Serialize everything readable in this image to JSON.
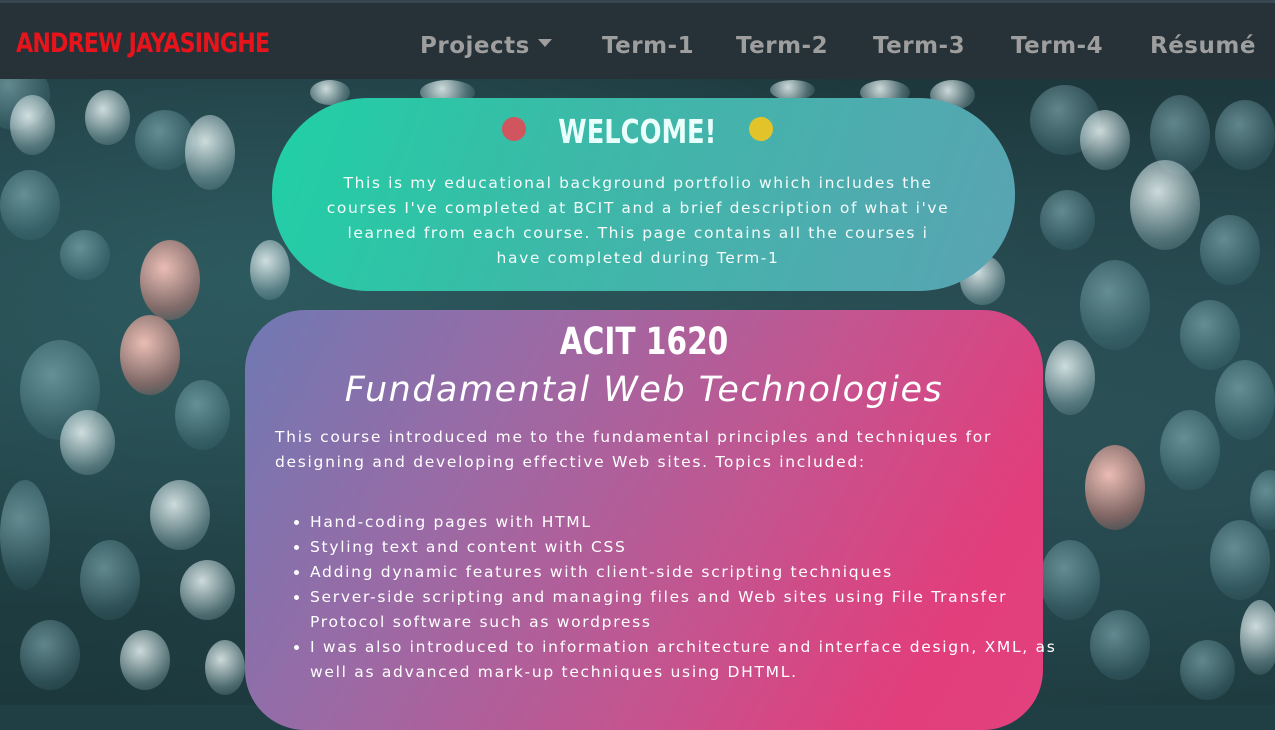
{
  "brand": "ANDREW JAYASINGHE",
  "nav": {
    "projects": "Projects",
    "term1": "Term-1",
    "term2": "Term-2",
    "term3": "Term-3",
    "term4": "Term-4",
    "resume": "Résumé"
  },
  "welcome": {
    "title": "WELCOME!",
    "body": "This is my educational background portfolio which includes the courses I've completed at BCIT and a brief description of what i've learned from each course. This page contains all the courses i have completed during Term-1"
  },
  "course": {
    "code": "ACIT 1620",
    "name": "Fundamental Web Technologies",
    "intro": "This course introduced me to the fundamental principles and techniques for designing and developing effective Web sites. Topics included:",
    "topics": [
      "Hand-coding pages with HTML",
      "Styling text and content with CSS",
      "Adding dynamic features with client-side scripting techniques",
      "Server-side scripting and managing files and Web sites using File Transfer Protocol software such as wordpress",
      "I was also introduced to information architecture and interface design, XML, as well as advanced mark-up techniques using DHTML."
    ]
  },
  "colors": {
    "brand": "#e8141b",
    "navbar": "#263238",
    "nav_text": "#9e9e9e",
    "welcome_gradient_start": "#1fd1a5",
    "welcome_gradient_end": "#5aa3b3",
    "course_gradient_start": "#6f79b3",
    "course_gradient_end": "#e3417e",
    "dot_red": "#d1555e",
    "dot_yellow": "#e2c42a"
  },
  "icons": {
    "dropdown": "caret-down-icon",
    "welcome_left": "red-dot-icon",
    "welcome_right": "yellow-dot-icon"
  }
}
